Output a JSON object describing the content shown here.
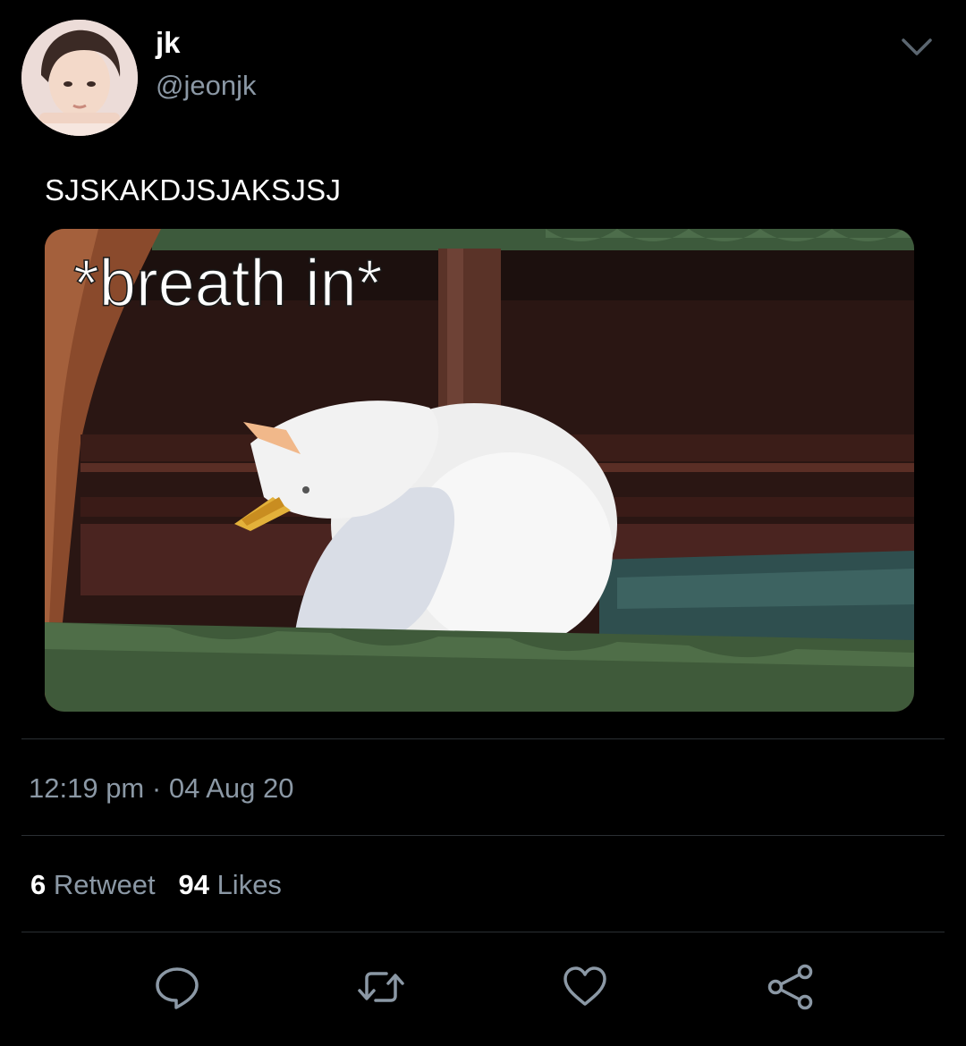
{
  "user": {
    "display_name": "jk",
    "handle": "@jeonjk"
  },
  "tweet": {
    "text": "SJSKAKDJSJAKSJSJ",
    "media_caption": "*breath in*",
    "time": "12:19 pm",
    "separator": "·",
    "date": "04 Aug 20"
  },
  "stats": {
    "retweets_count": "6",
    "retweets_label": "Retweet",
    "likes_count": "94",
    "likes_label": "Likes"
  },
  "actions": {
    "icons": [
      "reply-icon",
      "retweet-icon",
      "like-icon",
      "share-icon"
    ]
  },
  "colors": {
    "background": "#000000",
    "text_primary": "#ffffff",
    "text_secondary": "#8b98a5",
    "divider": "#2a2f33"
  }
}
